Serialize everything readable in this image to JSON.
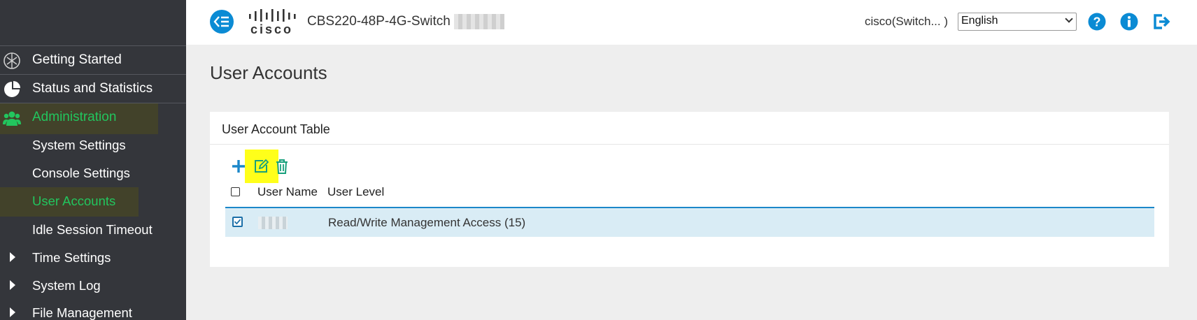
{
  "sidebar": {
    "items": [
      {
        "label": "Getting Started",
        "icon": "getting-started-icon"
      },
      {
        "label": "Status and Statistics",
        "icon": "pie-chart-icon"
      },
      {
        "label": "Administration",
        "icon": "users-icon"
      }
    ],
    "subitems": [
      {
        "label": "System Settings"
      },
      {
        "label": "Console Settings"
      },
      {
        "label": "User Accounts"
      },
      {
        "label": "Idle Session Timeout"
      },
      {
        "label": "Time Settings"
      },
      {
        "label": "System Log"
      },
      {
        "label": "File Management"
      }
    ]
  },
  "header": {
    "logo_text": "cisco",
    "device_name": "CBS220-48P-4G-Switch",
    "user": "cisco(Switch... )",
    "language": "English",
    "icons": [
      "collapse-icon",
      "help-icon",
      "info-icon",
      "logout-icon"
    ]
  },
  "page": {
    "title": "User Accounts"
  },
  "table": {
    "title": "User Account Table",
    "toolbar": [
      "add-icon",
      "edit-icon",
      "delete-icon"
    ],
    "columns": [
      "User Name",
      "User Level"
    ],
    "rows": [
      {
        "user_level": "Read/Write Management Access (15)",
        "selected": true
      }
    ]
  },
  "colors": {
    "accent": "#0b8bd4",
    "active_nav": "#22c55e",
    "highlight": "#ffff1a",
    "sidebar_bg": "#34363b"
  }
}
